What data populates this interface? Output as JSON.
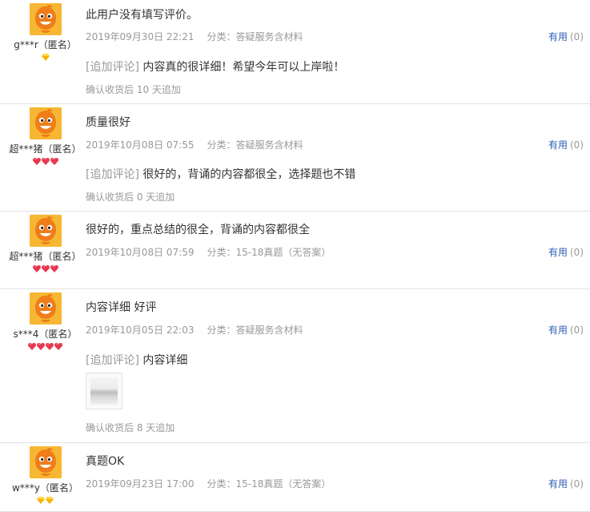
{
  "reviews": [
    {
      "username": "g***r（匿名）",
      "badge_type": "diamond",
      "badge_count": 1,
      "text": "此用户没有填写评价。",
      "date": "2019年09月30日 22:21",
      "category": "分类：答疑服务含材料",
      "useful_label": "有用",
      "useful_count": "(0)",
      "append_tag": "[追加评论]",
      "append_text": " 内容真的很详细！希望今年可以上岸啦！",
      "append_note": "确认收货后 10 天追加"
    },
    {
      "username": "超***猪（匿名）",
      "badge_type": "heart",
      "badge_count": 3,
      "text": "质量很好",
      "date": "2019年10月08日 07:55",
      "category": "分类：答疑服务含材料",
      "useful_label": "有用",
      "useful_count": "(0)",
      "append_tag": "[追加评论]",
      "append_text": " 很好的，背诵的内容都很全，选择题也不错",
      "append_note": "确认收货后 0 天追加"
    },
    {
      "username": "超***猪（匿名）",
      "badge_type": "heart",
      "badge_count": 3,
      "text": "很好的，重点总结的很全，背诵的内容都很全",
      "date": "2019年10月08日 07:59",
      "category": "分类：15-18真题（无答案）",
      "useful_label": "有用",
      "useful_count": "(0)"
    },
    {
      "username": "s***4（匿名）",
      "badge_type": "heart",
      "badge_count": 4,
      "text": "内容详细 好评",
      "date": "2019年10月05日 22:03",
      "category": "分类：答疑服务含材料",
      "useful_label": "有用",
      "useful_count": "(0)",
      "append_tag": "[追加评论]",
      "append_text": " 内容详细",
      "append_note": "确认收货后 8 天追加",
      "has_photo": true
    },
    {
      "username": "w***y（匿名）",
      "badge_type": "diamond",
      "badge_count": 2,
      "text": "真题OK",
      "date": "2019年09月23日 17:00",
      "category": "分类：15-18真题（无答案）",
      "useful_label": "有用",
      "useful_count": "(0)"
    }
  ],
  "colors": {
    "link": "#2b5fb4",
    "muted": "#999999",
    "text": "#333333",
    "divider": "#e2e2e2",
    "diamond_badge": "#f5b400",
    "heart_badge": "#e8384f",
    "avatar": "#f6a623"
  },
  "icons": {
    "avatar": "orange-cartoon-avatar-icon",
    "diamond": "yellow-diamond-badge-icon",
    "heart": "red-heart-badge-icon"
  }
}
